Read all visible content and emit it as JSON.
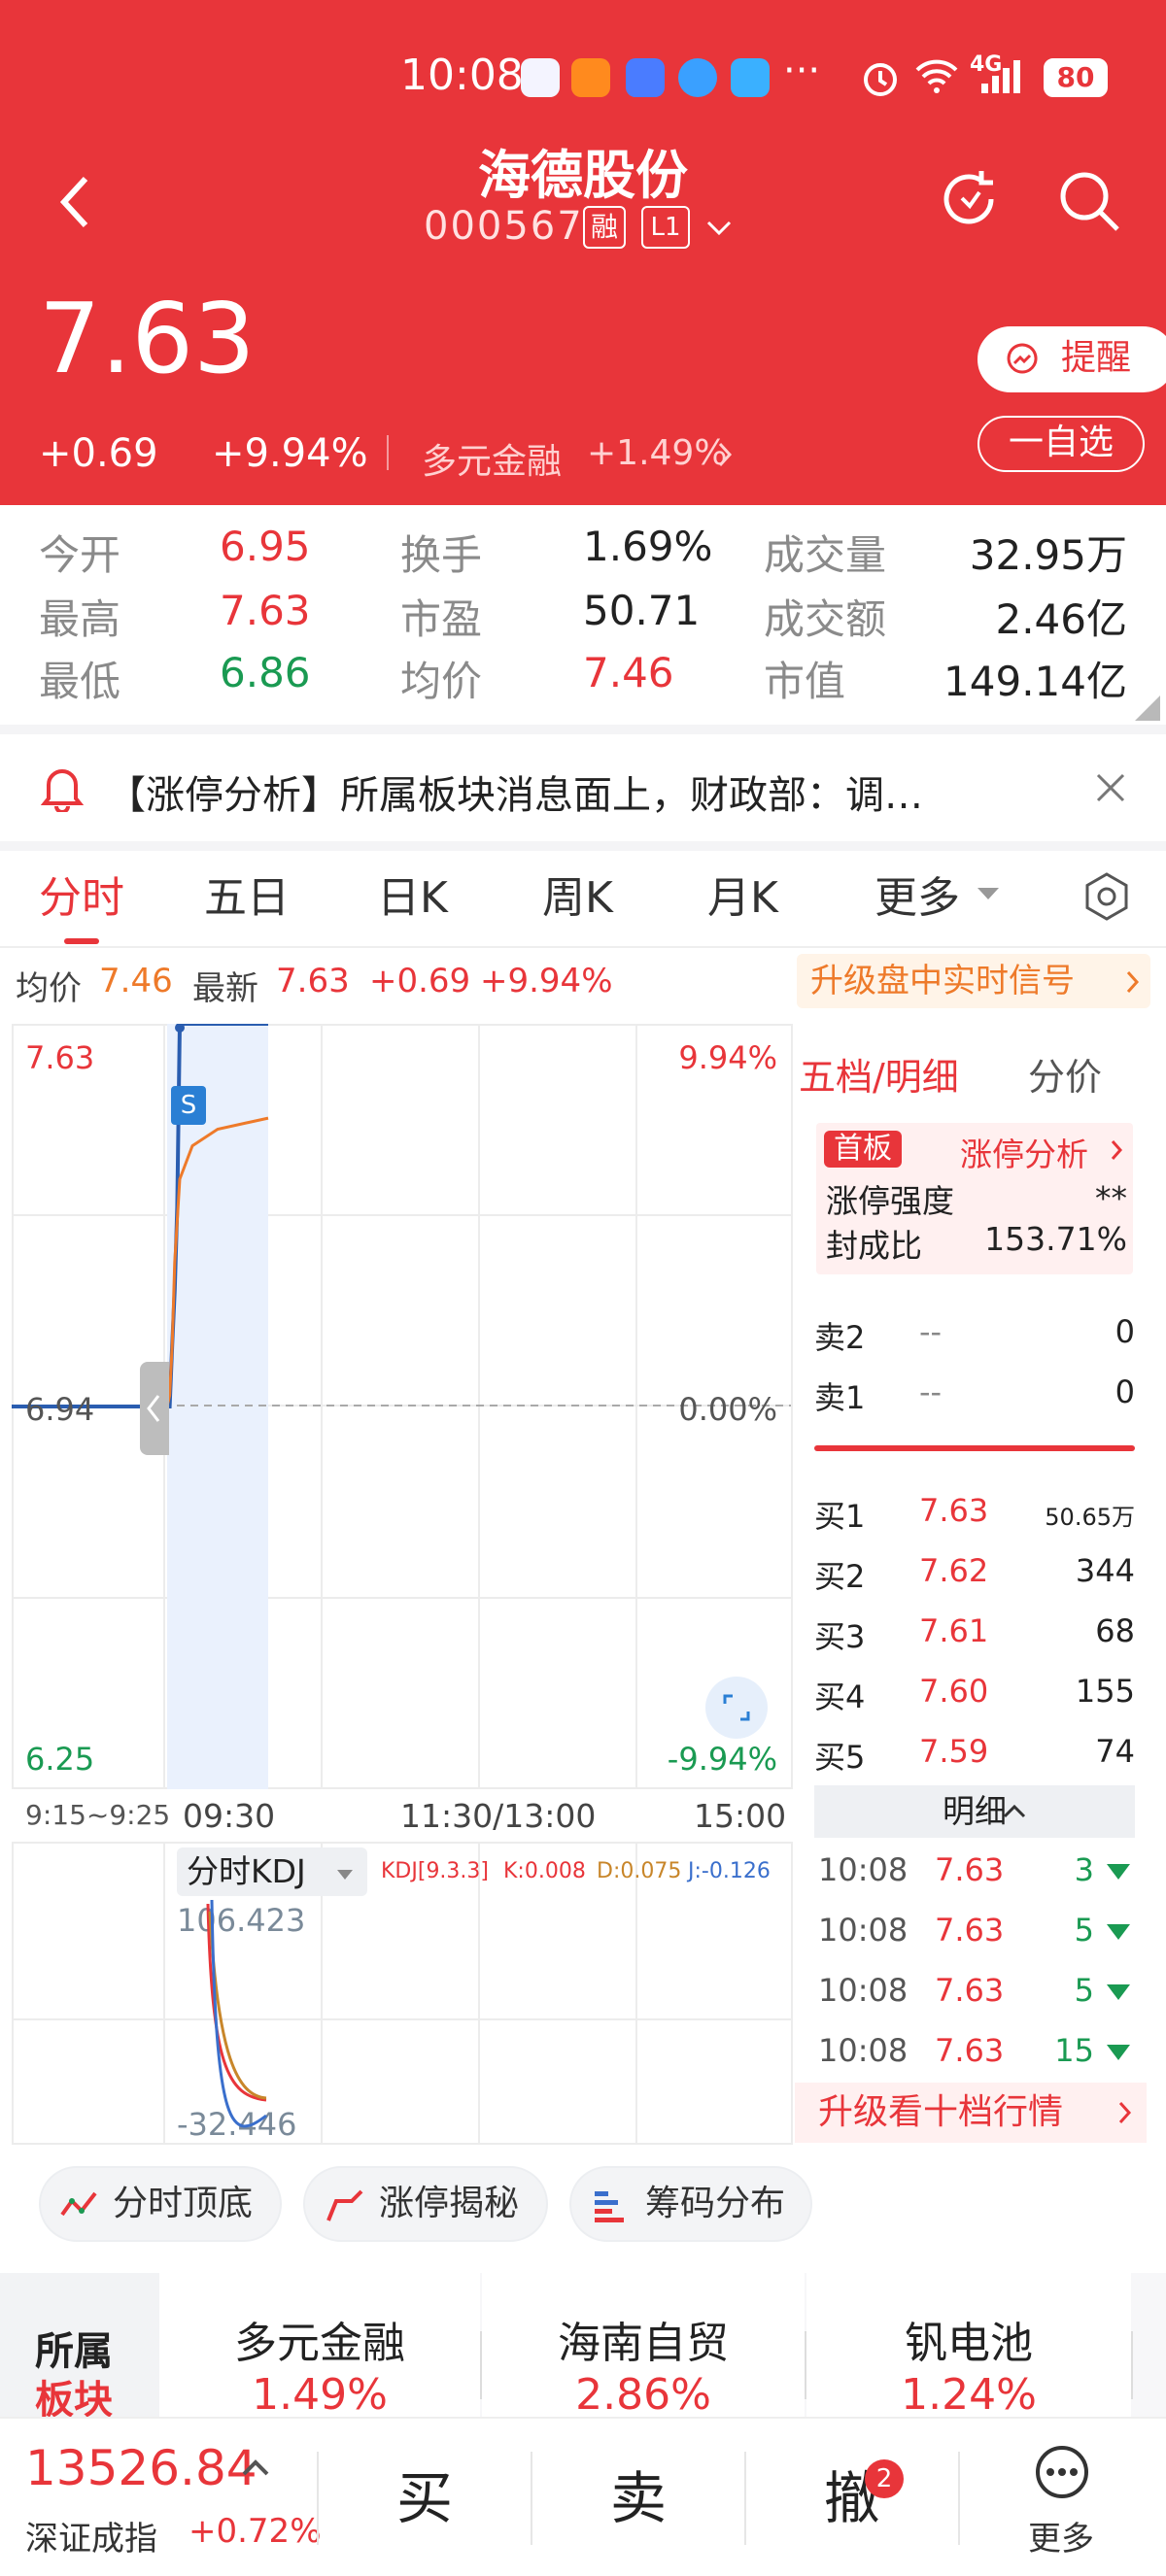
{
  "status_bar": {
    "time": "10:08",
    "more": "···",
    "network": "4G",
    "battery": "80"
  },
  "header": {
    "stock_name": "海德股份",
    "stock_code": "000567",
    "margin_badge": "融",
    "level_badge": "L1",
    "price": "7.63",
    "change": "+0.69",
    "change_pct": "+9.94%",
    "sector": "多元金融",
    "sector_change": "+1.49%",
    "remind_label": "提醒",
    "watchlist_label": "一自选"
  },
  "stats": [
    [
      {
        "label": "今开",
        "value": "6.95",
        "color": "red"
      },
      {
        "label": "换手",
        "value": "1.69%",
        "color": "dark"
      },
      {
        "label": "成交量",
        "value": "32.95万",
        "color": "dark"
      }
    ],
    [
      {
        "label": "最高",
        "value": "7.63",
        "color": "red"
      },
      {
        "label": "市盈",
        "value": "50.71",
        "color": "dark"
      },
      {
        "label": "成交额",
        "value": "2.46亿",
        "color": "dark"
      }
    ],
    [
      {
        "label": "最低",
        "value": "6.86",
        "color": "green"
      },
      {
        "label": "均价",
        "value": "7.46",
        "color": "red"
      },
      {
        "label": "市值",
        "value": "149.14亿",
        "color": "dark"
      }
    ]
  ],
  "notice": {
    "text": "【涨停分析】所属板块消息面上，财政部：调…"
  },
  "tabs": [
    "分时",
    "五日",
    "日K",
    "周K",
    "月K",
    "更多"
  ],
  "chart_header": {
    "avg_label": "均价",
    "avg_value": "7.46",
    "latest_label": "最新",
    "latest_value": "7.63",
    "change": "+0.69",
    "change_pct": "+9.94%",
    "upgrade_text": "升级盘中实时信号"
  },
  "chart_data": {
    "type": "line",
    "price_top": "7.63",
    "price_mid": "6.94",
    "price_bottom": "6.25",
    "pct_top": "9.94%",
    "pct_mid": "0.00%",
    "pct_bottom": "-9.94%",
    "x_labels": [
      "9:15~9:25",
      "09:30",
      "11:30/13:00",
      "15:00"
    ],
    "ylim": [
      6.25,
      7.63
    ],
    "series": [
      {
        "name": "最新",
        "color": "#2a5db0",
        "x": [
          0,
          1,
          2,
          3,
          4,
          5,
          8,
          40
        ],
        "y": [
          6.94,
          6.94,
          7.05,
          7.15,
          7.3,
          7.63,
          7.63,
          7.63
        ]
      },
      {
        "name": "均价",
        "color": "#ee7a2a",
        "x": [
          0,
          1,
          2,
          3,
          5,
          10,
          20,
          40
        ],
        "y": [
          6.94,
          6.96,
          7.05,
          7.2,
          7.35,
          7.41,
          7.44,
          7.46
        ]
      }
    ],
    "pre_market": {
      "x": [
        0,
        1
      ],
      "y": [
        6.94,
        6.94
      ]
    },
    "sell_marker": "S"
  },
  "order_book": {
    "tab_label": "五档/明细",
    "price_tab": "分价",
    "first_board": "首板",
    "limit_analysis": "涨停分析",
    "strength_label": "涨停强度",
    "strength_value": "**",
    "seal_label": "封成比",
    "seal_value": "153.71%",
    "sells": [
      {
        "label": "卖2",
        "price": "--",
        "vol": "0"
      },
      {
        "label": "卖1",
        "price": "--",
        "vol": "0"
      }
    ],
    "buys": [
      {
        "label": "买1",
        "price": "7.63",
        "vol": "50.65万"
      },
      {
        "label": "买2",
        "price": "7.62",
        "vol": "344"
      },
      {
        "label": "买3",
        "price": "7.61",
        "vol": "68"
      },
      {
        "label": "买4",
        "price": "7.60",
        "vol": "155"
      },
      {
        "label": "买5",
        "price": "7.59",
        "vol": "74"
      }
    ],
    "detail_label": "明细",
    "trades": [
      {
        "time": "10:08",
        "price": "7.63",
        "vol": "3"
      },
      {
        "time": "10:08",
        "price": "7.63",
        "vol": "5"
      },
      {
        "time": "10:08",
        "price": "7.63",
        "vol": "5"
      },
      {
        "time": "10:08",
        "price": "7.63",
        "vol": "15"
      }
    ],
    "upgrade_label": "升级看十档行情"
  },
  "kdj": {
    "selector": "分时KDJ",
    "param": "KDJ[9.3.3]",
    "k": "K:0.008",
    "d": "D:0.075",
    "j": "J:-0.126",
    "top_value": "106.423",
    "bottom_value": "-32.446"
  },
  "chips": [
    "分时顶底",
    "涨停揭秘",
    "筹码分布"
  ],
  "sector_strip": {
    "label_top": "所属",
    "label_bottom": "板块",
    "items": [
      {
        "name": "多元金融",
        "pct": "1.49%"
      },
      {
        "name": "海南自贸",
        "pct": "2.86%"
      },
      {
        "name": "钒电池",
        "pct": "1.24%"
      }
    ]
  },
  "bottom_bar": {
    "index_value": "13526.84",
    "index_name": "深证成指",
    "index_change": "+0.72%",
    "buy": "买",
    "sell": "卖",
    "cancel": "撤",
    "cancel_badge": "2",
    "more": "更多"
  },
  "colors": {
    "brand_red": "#e8353a",
    "up": "#e8353a",
    "down": "#1a9a52",
    "avg_line": "#ee7a2a",
    "price_line": "#2a5db0"
  }
}
